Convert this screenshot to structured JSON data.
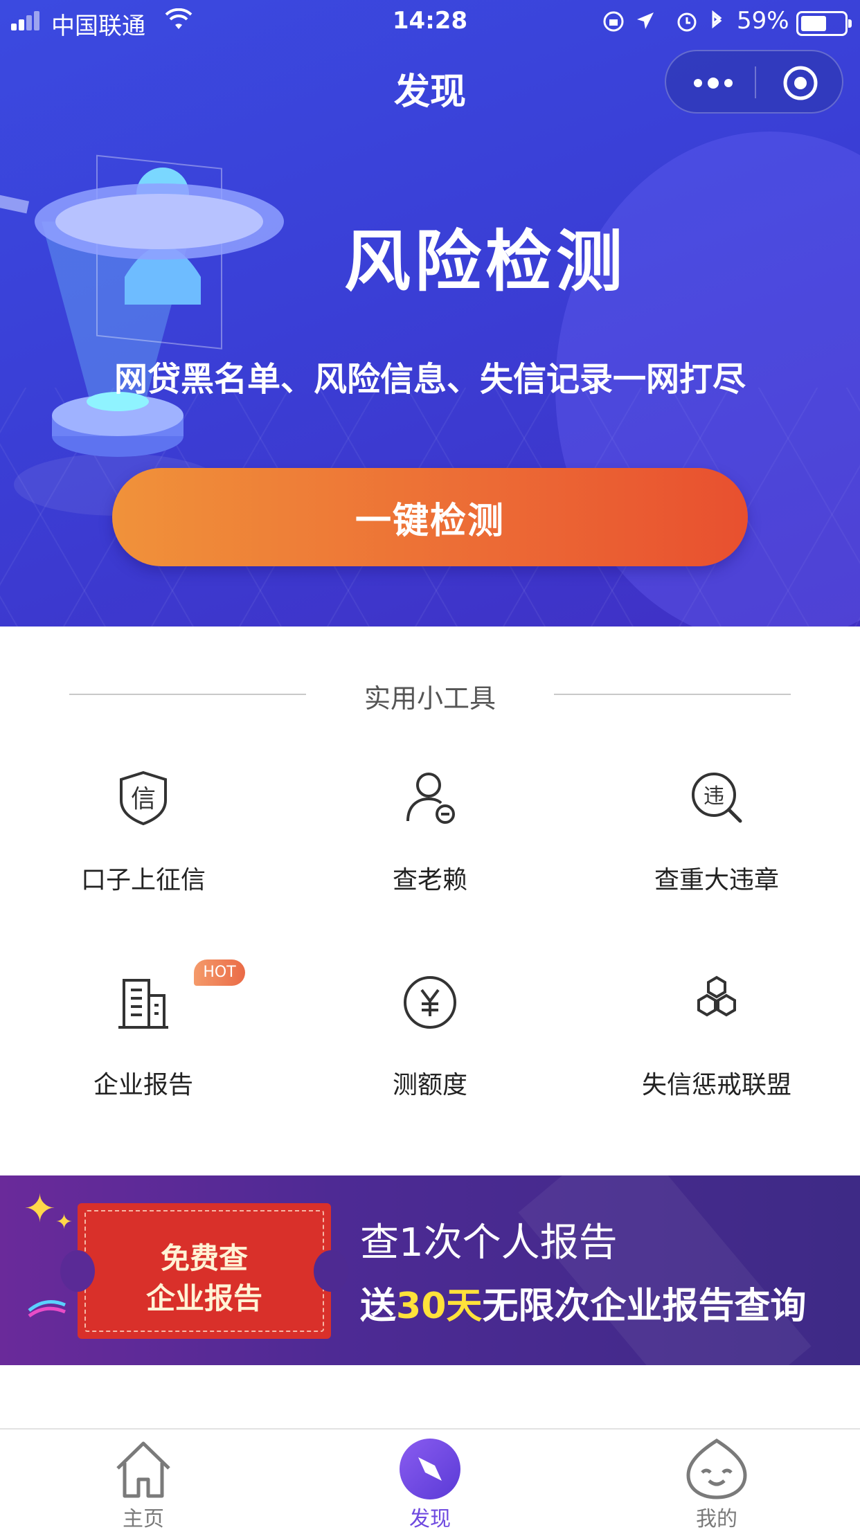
{
  "status_bar": {
    "carrier": "中国联通",
    "time": "14:28",
    "battery": "59%"
  },
  "nav": {
    "title": "发现",
    "more_icon": "more-dots-icon",
    "close_icon": "target-icon"
  },
  "hero": {
    "title": "风险检测",
    "subtitle": "网贷黑名单、风险信息、失信记录一网打尽",
    "cta": "一键检测",
    "cta_colors": [
      "#f0923a",
      "#e8502f"
    ]
  },
  "tools": {
    "heading": "实用小工具",
    "items": [
      {
        "label": "口子上征信",
        "icon": "shield-xin-icon"
      },
      {
        "label": "查老赖",
        "icon": "person-minus-icon"
      },
      {
        "label": "查重大违章",
        "icon": "magnifier-wei-icon"
      },
      {
        "label": "企业报告",
        "icon": "building-icon",
        "badge": "HOT"
      },
      {
        "label": "测额度",
        "icon": "yen-circle-icon"
      },
      {
        "label": "失信惩戒联盟",
        "icon": "hexagons-icon"
      }
    ]
  },
  "banner": {
    "ticket_line1": "免费查",
    "ticket_line2": "企业报告",
    "line1": "查1次个人报告",
    "line2_prefix": "送",
    "line2_highlight": "30天",
    "line2_suffix": "无限次企业报告查询"
  },
  "tabbar": {
    "items": [
      {
        "label": "主页",
        "icon": "home-icon"
      },
      {
        "label": "发现",
        "icon": "compass-icon",
        "active": true
      },
      {
        "label": "我的",
        "icon": "smiley-face-icon"
      }
    ],
    "accent": "#6f4ae0"
  }
}
